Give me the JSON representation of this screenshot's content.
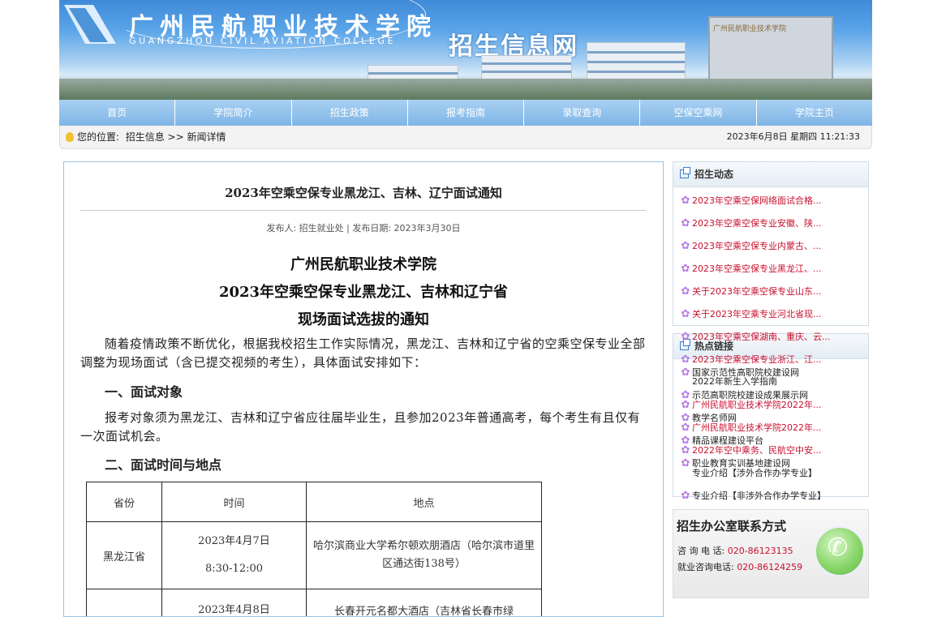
{
  "banner": {
    "college_cn": "广州民航职业技术学院",
    "college_en": "GUANGZHOU CIVIL AVIATION COLLEGE",
    "site_title": "招生信息网",
    "gate_text": "广州民航职业技术学院"
  },
  "nav": [
    "首页",
    "学院简介",
    "招生政策",
    "报考指南",
    "录取查询",
    "空保空乘网",
    "学院主页"
  ],
  "breadcrumb": {
    "prefix": "您的位置:",
    "item1": "招生信息",
    "sep": ">>",
    "item2": "新闻详情",
    "datetime": "2023年6月8日  星期四  11:21:33"
  },
  "article": {
    "title": "2023年空乘空保专业黑龙江、吉林、辽宁面试通知",
    "meta": "发布人: 招生就业处  |   发布日期: 2023年3月30日",
    "h_line1": "广州民航职业技术学院",
    "h_line2": "2023年空乘空保专业黑龙江、吉林和辽宁省",
    "h_line3": "现场面试选拔的通知",
    "para1": "随着疫情政策不断优化，根据我校招生工作实际情况，黑龙江、吉林和辽宁省的空乘空保专业全部调整为现场面试（含已提交视频的考生），具体面试安排如下：",
    "sec1": "一、面试对象",
    "para2": "报考对象须为黑龙江、吉林和辽宁省应往届毕业生，且参加2023年普通高考，每个考生有且仅有一次面试机会。",
    "sec2": "二、面试时间与地点",
    "table": {
      "headers": [
        "省份",
        "时间",
        "地点"
      ],
      "rows": [
        {
          "province": "黑龙江省",
          "date": "2023年4月7日",
          "time": "8:30-12:00",
          "place": "哈尔滨商业大学希尔顿欢朋酒店（哈尔滨市道里区通达街138号）"
        },
        {
          "province": "",
          "date": "2023年4月8日",
          "time": "",
          "place": "长春开元名都大酒店（吉林省长春市绿"
        }
      ]
    }
  },
  "sidebar": {
    "news_title": "招生动态",
    "news": [
      "2023年空乘空保网络面试合格...",
      "2023年空乘空保专业安徽、陕...",
      "2023年空乘空保专业内蒙古、...",
      "2023年空乘空保专业黑龙江、...",
      "关于2023年空乘空保专业山东...",
      "关于2023年空乘专业河北省现...",
      "2023年空乘空保湖南、重庆、云...",
      "2023年空乘空保专业浙江、江...",
      "广州民航职业技术学院2022年...",
      "广州民航职业技术学院2022年...",
      "2022年空中乘务、民航空中安..."
    ],
    "links_title": "热点链接",
    "links": [
      "国家示范性高职院校建设网",
      "2022年新生入学指南",
      "示范高职院校建设成果展示网",
      "教学名师网",
      "精品课程建设平台",
      "职业教育实训基地建设网",
      "专业介绍【涉外合作办学专业】",
      "专业介绍【非涉外合作办学专业】"
    ],
    "contact": {
      "title": "招生办公室联系方式",
      "phone_label": "咨 询 电  话:",
      "phone": "020-86123135",
      "job_label": "就业咨询电话:",
      "job_phone": "020-86124259"
    }
  },
  "colors": {
    "nav_bg": "#8fc1ec",
    "accent_red": "#c8102e",
    "border_blue": "#9bc3e3"
  }
}
